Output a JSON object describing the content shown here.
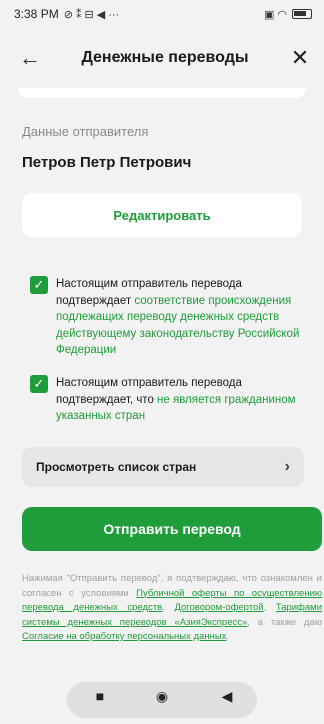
{
  "status": {
    "time": "3:38 PM",
    "left_icons": "⊘ ⁑ ⊟ ◀ ···",
    "right_icons": "▣ ◠"
  },
  "header": {
    "title": "Денежные переводы",
    "back_icon": "←",
    "close_icon": "✕"
  },
  "sender": {
    "section_label": "Данные отправителя",
    "name": "Петров Петр Петрович",
    "edit_label": "Редактировать"
  },
  "checks": [
    {
      "text_plain": "Настоящим отправитель перевода подтверждает ",
      "text_link": "соответствие происхождения подлежащих переводу денежных средств действующему законодательству Российской Федерации",
      "checked": true
    },
    {
      "text_plain": "Настоящим отправитель перевода подтверждает, что ",
      "text_link": "не является гражданином указанных стран",
      "checked": true
    }
  ],
  "countries_label": "Просмотреть список стран",
  "send_label": "Отправить перевод",
  "legal": {
    "p1": "Нажимая \"Отправить перевод\", я подтверждаю, что ознакомлен и согласен с условиями ",
    "l1": "Публичной оферты по осуществлению перевода денежных средств",
    "p2": ", ",
    "l2": "Договором-офертой",
    "p3": ", ",
    "l3": "Тарифами системы денежных переводов «АзияЭкспресс»",
    "p4": ", а также даю ",
    "l4": "Согласие на обработку персональных данных",
    "p5": "."
  },
  "nav": {
    "square": "■",
    "circle": "◉",
    "back": "◀"
  },
  "colors": {
    "accent": "#1f9d3a",
    "background": "#f2f2f2",
    "card": "#ffffff"
  }
}
